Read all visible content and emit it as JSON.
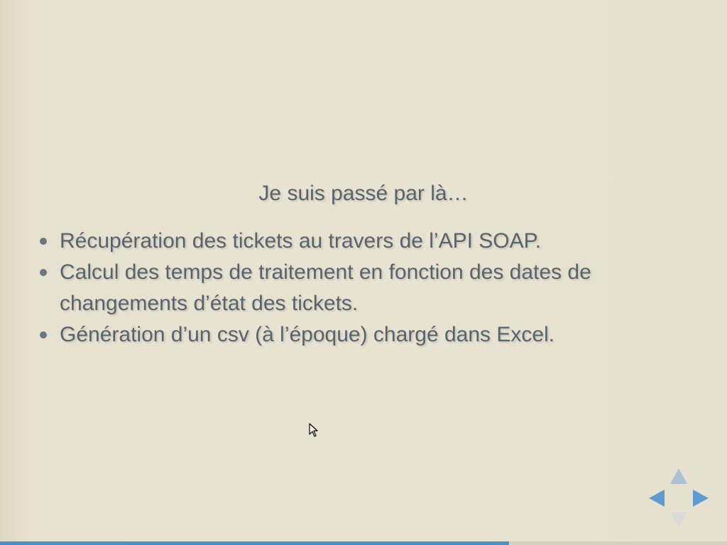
{
  "slide": {
    "title": "Je suis passé par là…",
    "bullets": [
      {
        "text": "Récupération des tickets au travers de l’API SOAP."
      },
      {
        "text": "Calcul des temps de traitement en fonction des dates de changements d’état des tickets."
      },
      {
        "text": "Génération d’un csv (à l’époque) chargé dans Excel."
      }
    ]
  },
  "navigation": {
    "icons": [
      "arrow-up-icon",
      "arrow-left-icon",
      "arrow-right-icon",
      "arrow-down-icon"
    ],
    "active_color": "#5d9cd0",
    "inactive_color": "#a9c3d6"
  },
  "progress": {
    "fraction": 0.7,
    "color": "#4a90c8"
  },
  "colors": {
    "background": "#e8e2d0",
    "text": "#56636e"
  }
}
